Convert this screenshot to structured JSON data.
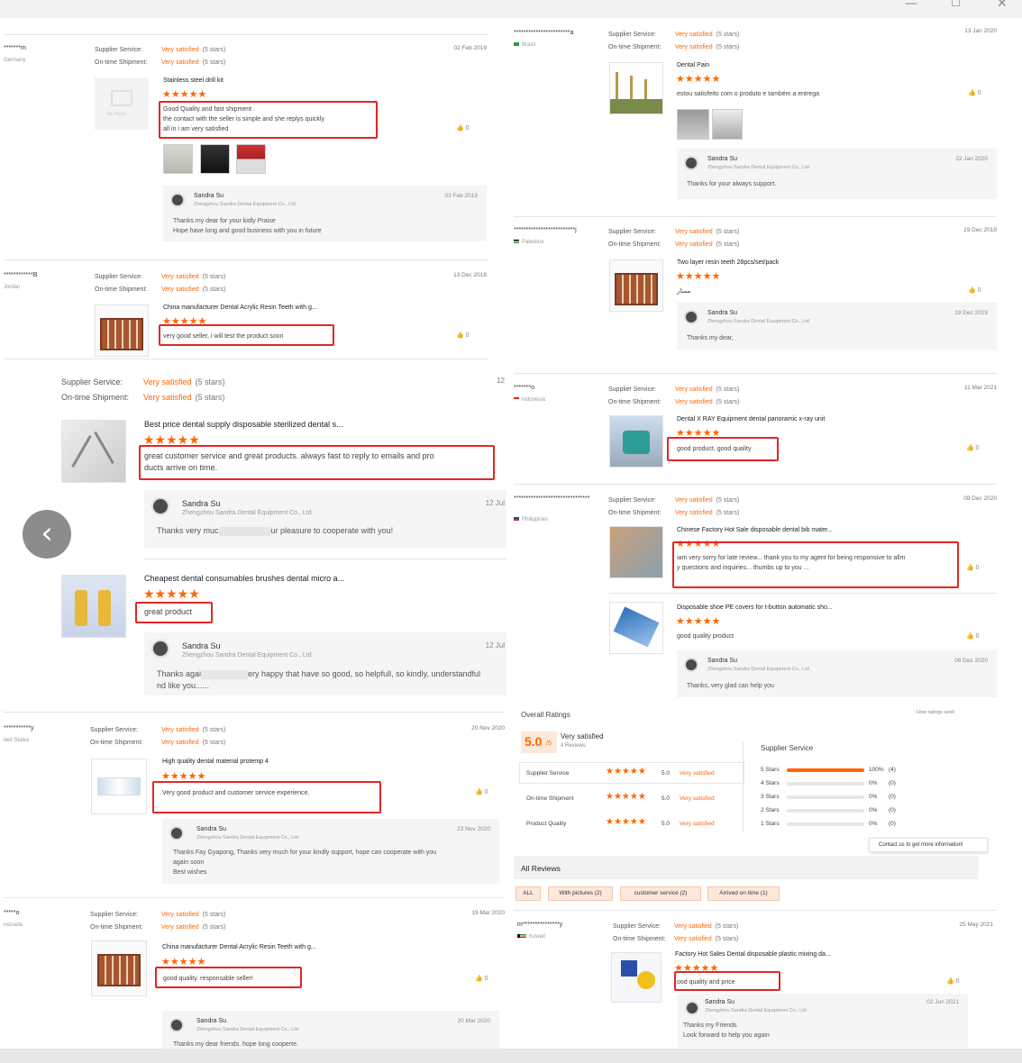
{
  "window": {
    "minimize": "—",
    "maximize": "☐",
    "close": "✕"
  },
  "labels": {
    "supplier_service": "Supplier Service:",
    "ontime_shipment": "On-time Shipment:",
    "very_satisfied": "Very satisfied",
    "five_stars": "(5 stars)",
    "stars": "★★★★★",
    "seller_name": "Sandra Su",
    "seller_company": "Zhengzhou Sandra Dental Equipment Co., Ltd",
    "like_icon": "thumbs-up-icon"
  },
  "left": {
    "r1": {
      "user": "*******m",
      "country": "Germany",
      "date": "02 Feb 2019",
      "title": "Stainless steel drill kit",
      "text": "Good Quality and fast shipment .\nthe contact with the seller is simple and she replys quickly\nall in i am very satisfied",
      "likes": "0",
      "nophoto": "No Photo",
      "reply_date": "03 Feb 2019",
      "reply": "Thanks my dear for your kidly Praise\nHope have long and good business with you in future"
    },
    "r2": {
      "user": "************B",
      "country": "Jordan",
      "date": "13 Dec 2018",
      "title": "China manufacturer Dental Acrylic Resin Teeth with g...",
      "text": "very good seller, i will test the product soon",
      "likes": "0"
    },
    "r3": {
      "date": "12",
      "title": "Best price dental supply disposable sterilized dental s...",
      "text": "great customer service and great products. always fast to reply to emails and pro\nducts arrive on time.",
      "reply_date": "12 Jul",
      "reply_a": "Thanks very muc",
      "reply_b": "ur pleasure to cooperate with you!"
    },
    "r4": {
      "title": "Cheapest dental consumables brushes dental micro a...",
      "text": "great product",
      "reply_date": "12 Jul",
      "reply_a": "Thanks agai",
      "reply_b": "ery happy that have so good, so helpfull, so kindly, understandful",
      "reply_c": "nd like you......"
    },
    "r5": {
      "user": "***********y",
      "country": "ited States",
      "date": "20 Nov 2020",
      "title": "High quality dental material protemp 4",
      "text": "Very good product and customer service experience.",
      "likes": "0",
      "reply_date": "23 Nov 2020",
      "reply": "Thanks Fay Gyapong, Thanks very much for your kindly support, hope can cooperate with you\nagain soon\nBest wishes"
    },
    "r6": {
      "user": "*****o",
      "country": "nezuela",
      "date": "19 Mar 2020",
      "title": "China manufacturer Dental Acrylic Resin Teeth with g...",
      "text": "good quality. responsable seller!",
      "likes": "0",
      "reply_date": "20 Mar 2020",
      "reply": "Thanks my dear  friends. hope long cooperte."
    }
  },
  "right": {
    "r1": {
      "user": "***********************a",
      "country": "Brazil",
      "date": "13 Jan 2020",
      "title": "Dental Pain",
      "text": "estou satisfeito com o produto e também a entrega",
      "likes": "0",
      "reply_date": "22 Jan 2020",
      "reply": "Thanks for your always support."
    },
    "r2": {
      "user": "*************************j",
      "country": "Palestine",
      "date": "19 Dec 2019",
      "title": "Two layer resin teeth 28pcs/set/pack",
      "text": "ممتاز",
      "likes": "0",
      "reply_date": "19 Dec 2019",
      "reply": "Thanks my dear,"
    },
    "r3": {
      "user": "*******o",
      "country": "Indonesia",
      "date": "11 Mar 2021",
      "title": "Dental X RAY Equipment dental panoramic x-ray unit",
      "text": "good product, good quality",
      "likes": "0"
    },
    "r4": {
      "user": "*******************************",
      "country": "Philippines",
      "date": "08 Dec 2020",
      "title": "Chinese Factory Hot Sale disposable dental bib mater...",
      "text": "iam very sorry for late review... thank you to my agent for being responsive to allm\ny questions and inquiries... thumbs up to you ...",
      "likes": "0",
      "title2": "Disposable shoe PE covers for t-button automatic sho...",
      "text2": "good quality product",
      "likes2": "0",
      "reply_date": "08 Dec 2020",
      "reply": "Thanks, very glad can help  you"
    },
    "overall": {
      "heading": "Overall Ratings",
      "score": "5.0",
      "score_suffix": "/5",
      "verdict": "Very satisfied",
      "count": "4 Reviews",
      "how": "How ratings work",
      "rows": [
        {
          "label": "Supplier Service",
          "score": "5.0",
          "verdict": "Very satisfied"
        },
        {
          "label": "On-time Shipment",
          "score": "5.0",
          "verdict": "Very satisfied"
        },
        {
          "label": "Product Quality",
          "score": "5.0",
          "verdict": "Very satisfied"
        }
      ],
      "dist_title": "Supplier Service",
      "dist": [
        {
          "label": "5 Stars",
          "pct": "100%",
          "count": "(4)",
          "fill": 1.0
        },
        {
          "label": "4 Stars",
          "pct": "0%",
          "count": "(0)",
          "fill": 0
        },
        {
          "label": "3 Stars",
          "pct": "0%",
          "count": "(0)",
          "fill": 0
        },
        {
          "label": "2 Stars",
          "pct": "0%",
          "count": "(0)",
          "fill": 0
        },
        {
          "label": "1 Stars",
          "pct": "0%",
          "count": "(0)",
          "fill": 0
        }
      ],
      "contact": "Contact us to get more information!"
    },
    "all_reviews": {
      "heading": "All Reviews",
      "filters": [
        "ALL",
        "With pictures (2)",
        "customer service (2)",
        "Arrived on time (1)"
      ]
    },
    "r5": {
      "user": "m***************y",
      "country": "Kuwait",
      "date": "25 May 2021",
      "title": "Factory Hot Sales Dental disposable plastic mixing da...",
      "text": "ood quality and price",
      "likes": "0",
      "reply_date": "02 Jun 2021",
      "reply": "Thanks my Friends\nLook forward to help you again"
    }
  }
}
